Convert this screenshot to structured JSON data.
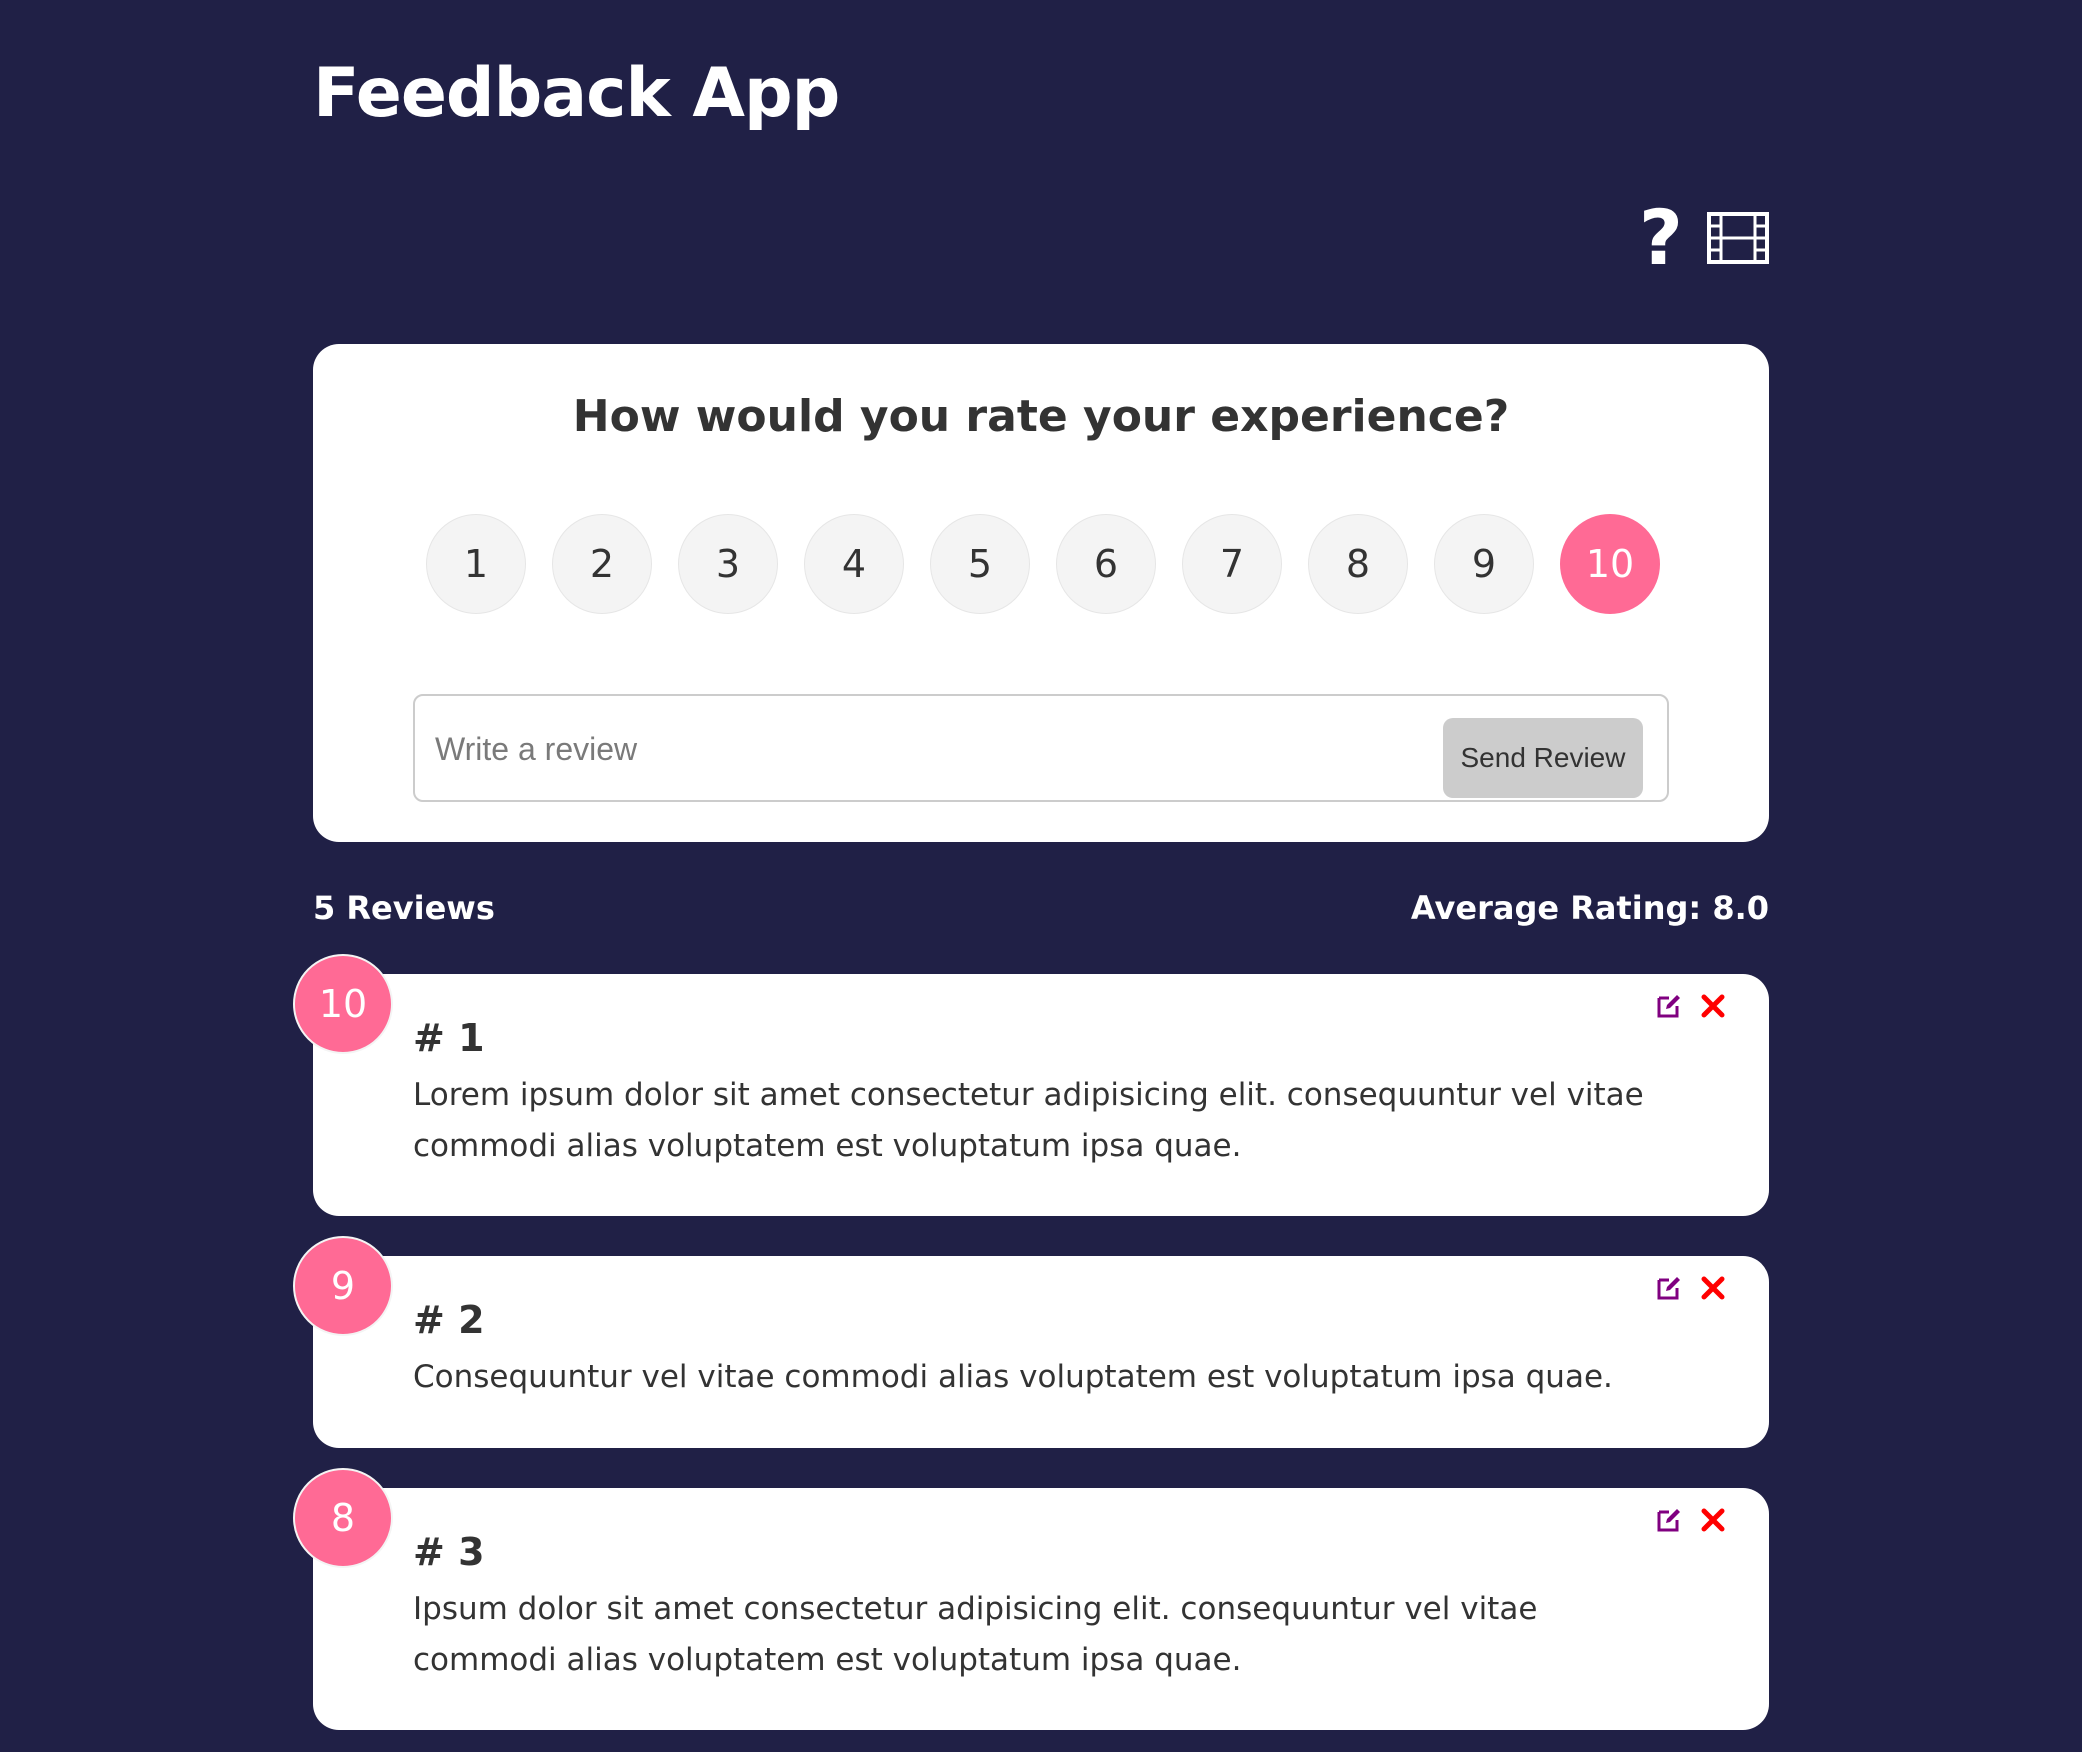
{
  "app": {
    "title": "Feedback App",
    "icons": [
      "question-icon",
      "film-icon"
    ]
  },
  "rating_form": {
    "question": "How would you rate your experience?",
    "options": [
      "1",
      "2",
      "3",
      "4",
      "5",
      "6",
      "7",
      "8",
      "9",
      "10"
    ],
    "selected": "10",
    "review_placeholder": "Write a review",
    "send_label": "Send Review"
  },
  "stats": {
    "count_label": "5 Reviews",
    "average_label": "Average Rating: 8.0"
  },
  "reviews": [
    {
      "rating": "10",
      "number": "# 1",
      "text": "Lorem ipsum dolor sit amet consectetur adipisicing elit. consequuntur vel vitae commodi alias voluptatem est voluptatum ipsa quae."
    },
    {
      "rating": "9",
      "number": "# 2",
      "text": "Consequuntur vel vitae commodi alias voluptatem est voluptatum ipsa quae."
    },
    {
      "rating": "8",
      "number": "# 3",
      "text": "Ipsum dolor sit amet consectetur adipisicing elit. consequuntur vel vitae commodi alias voluptatem est voluptatum ipsa quae."
    }
  ],
  "colors": {
    "background": "#202046",
    "accent": "#ff6a95",
    "edit": "#800080",
    "delete": "#ff0000"
  }
}
